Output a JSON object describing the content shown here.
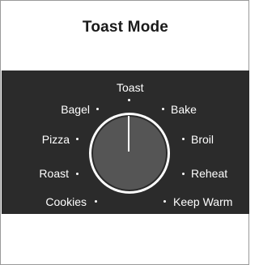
{
  "header": {
    "title": "Toast Mode"
  },
  "dial": {
    "selected": "Toast",
    "options": [
      "Toast",
      "Bake",
      "Broil",
      "Reheat",
      "Keep Warm",
      "Bagel",
      "Pizza",
      "Roast",
      "Cookies"
    ]
  },
  "colors": {
    "panel": "#2b2b2b",
    "knob_fill": "#555555",
    "knob_ring": "#ffffff",
    "text": "#ffffff",
    "title": "#1a1a1a"
  }
}
